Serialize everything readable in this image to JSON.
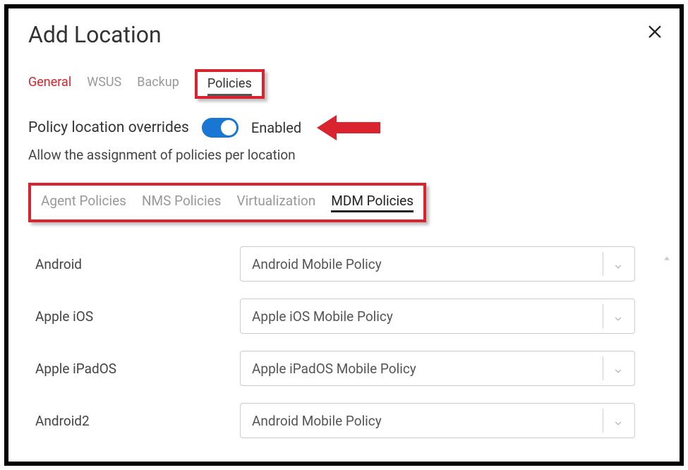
{
  "dialog": {
    "title": "Add Location"
  },
  "topTabs": {
    "general": "General",
    "wsus": "WSUS",
    "backup": "Backup",
    "policies": "Policies"
  },
  "overrides": {
    "label": "Policy location overrides",
    "status": "Enabled",
    "description": "Allow the assignment of policies per location"
  },
  "subTabs": {
    "agent": "Agent Policies",
    "nms": "NMS Policies",
    "virt": "Virtualization",
    "mdm": "MDM Policies"
  },
  "policies": [
    {
      "label": "Android",
      "value": "Android Mobile Policy"
    },
    {
      "label": "Apple iOS",
      "value": "Apple iOS Mobile Policy"
    },
    {
      "label": "Apple iPadOS",
      "value": "Apple iPadOS Mobile Policy"
    },
    {
      "label": "Android2",
      "value": "Android Mobile Policy"
    }
  ]
}
